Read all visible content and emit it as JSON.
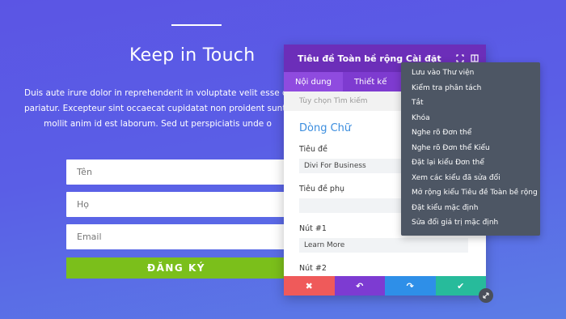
{
  "background": {
    "title": "Keep in Touch",
    "paragraph": [
      "Duis aute irure dolor in reprehenderit in voluptate velit esse cillum d",
      "pariatur. Excepteur sint occaecat cupidatat non proident sunt in culp",
      "mollit anim id est laborum. Sed ut perspiciatis unde o"
    ],
    "form": {
      "name_placeholder": "Tên",
      "surname_placeholder": "Họ",
      "email_placeholder": "Email",
      "submit_label": "ĐĂNG KÝ"
    }
  },
  "panel": {
    "title": "Tiêu đề Toàn bề rộng Cài đặt",
    "tabs": [
      "Nội dung",
      "Thiết kế"
    ],
    "search_placeholder": "Tùy chọn Tìm kiếm",
    "section_title": "Dòng Chữ",
    "fields": {
      "title_label": "Tiêu đề",
      "title_value": "Divi For Business",
      "subtitle_label": "Tiêu đề phụ",
      "subtitle_value": "",
      "button1_label": "Nút #1",
      "button1_value": "Learn More",
      "button2_label": "Nút #2"
    },
    "footer": {
      "cancel_icon": "✖",
      "undo_icon": "↶",
      "redo_icon": "↷",
      "save_icon": "✔"
    }
  },
  "menu": {
    "items": [
      "Lưu vào Thư viện",
      "Kiểm tra phân tách",
      "Tắt",
      "Khóa",
      "Nghe rõ Đơn thể",
      "Nghe rõ Đơn thể Kiểu",
      "Đặt lại kiểu Đơn thể",
      "Xem các kiểu đã sửa đổi",
      "Mở rộng kiểu Tiêu đề Toàn bề rộng",
      "Đặt kiểu mặc định",
      "Sửa đổi giá trị mặc định"
    ]
  }
}
